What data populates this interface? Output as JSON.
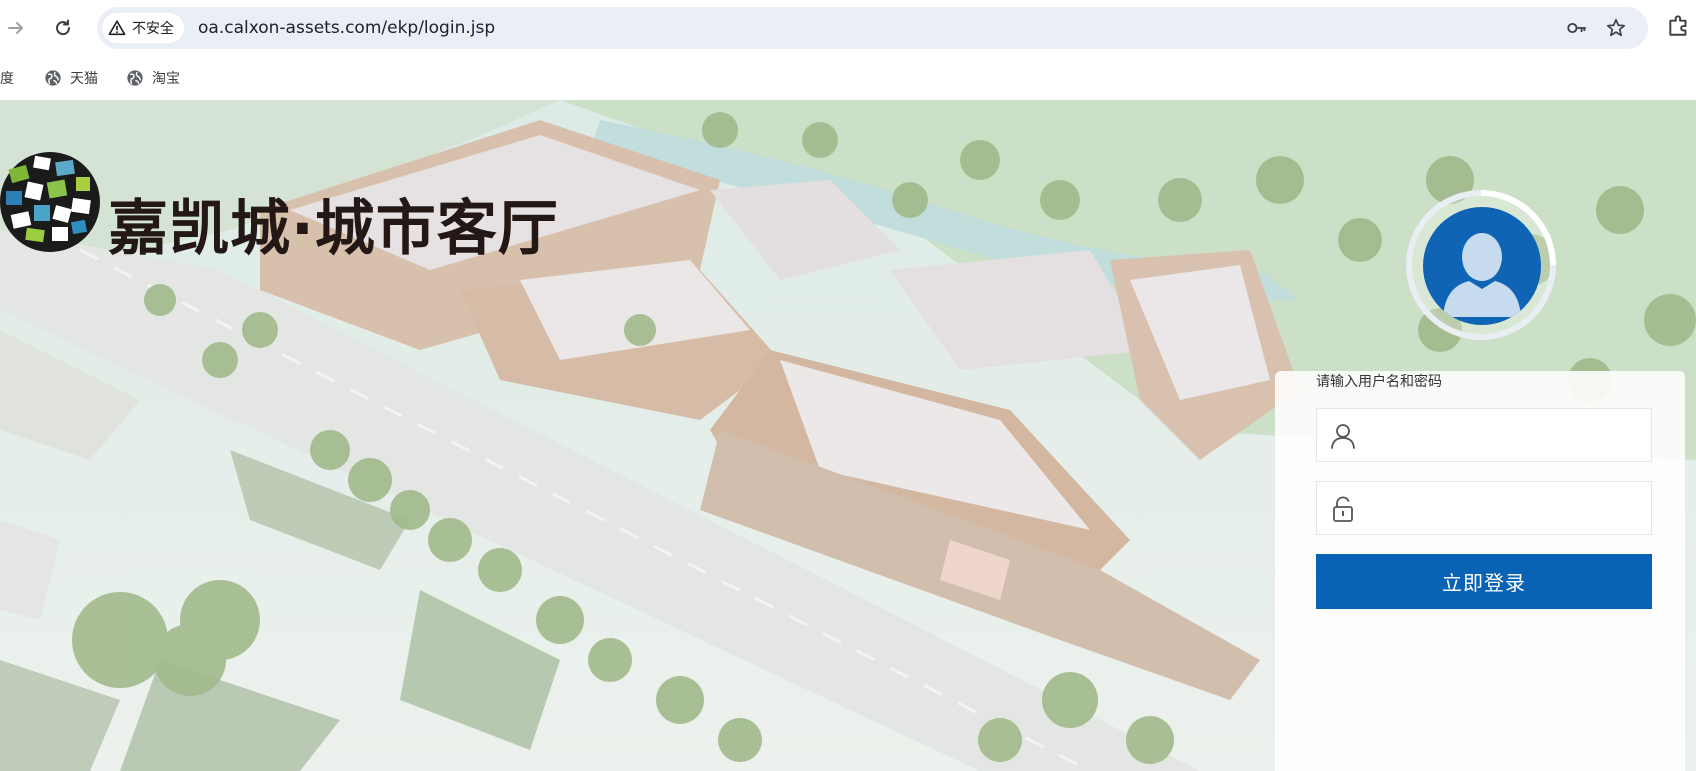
{
  "browser": {
    "security_label": "不安全",
    "url": "oa.calxon-assets.com/ekp/login.jsp",
    "icons": {
      "forward": "arrow-right-icon",
      "reload": "reload-icon",
      "warning": "warning-triangle-icon",
      "key": "key-icon",
      "bookmark": "star-icon",
      "extensions": "puzzle-icon"
    }
  },
  "bookmarks": [
    {
      "label": "百度"
    },
    {
      "label": "天猫"
    },
    {
      "label": "淘宝"
    }
  ],
  "page": {
    "brand_title": "嘉凯城·城市客厅",
    "login": {
      "prompt": "请输入用户名和密码",
      "username_value": "",
      "password_value": "",
      "submit_label": "立即登录"
    },
    "colors": {
      "primary": "#0a62b4",
      "avatar": "#1064b6"
    }
  }
}
